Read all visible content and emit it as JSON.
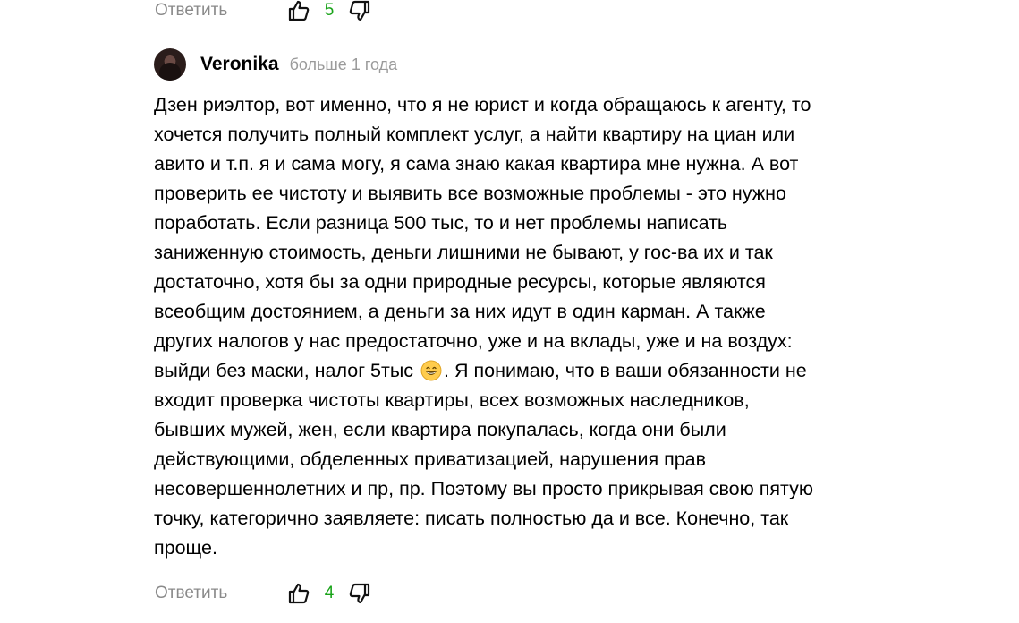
{
  "prev_comment": {
    "reply_label": "Ответить",
    "likes": "5"
  },
  "comment": {
    "author": "Veronika",
    "time": "больше 1 года",
    "lines": [
      "Дзен риэлтор, вот именно, что я не юрист и когда обращаюсь к агенту, то",
      "хочется получить полный комплект услуг, а найти квартиру на циан или",
      "авито и т.п. я и сама могу, я сама знаю какая квартира мне нужна. А вот",
      "проверить ее чистоту и выявить все возможные проблемы - это нужно",
      "поработать. Если разница 500 тыс, то и нет проблемы написать",
      "заниженную стоимость, деньги лишними не бывают, у гос-ва их и так",
      "достаточно, хотя бы за одни природные ресурсы, которые являются",
      "всеобщим достоянием, а деньги за них идут в один карман. А также",
      "других налогов у нас предостаточно, уже и на вклады, уже и на воздух:"
    ],
    "line_emoji_before": "выйди без маски, налог 5тыс",
    "line_emoji_after": ". Я понимаю, что в ваши обязанности не",
    "lines_after": [
      "входит проверка чистоты квартиры, всех возможных наследников,",
      "бывших мужей, жен, если квартира покупалась, когда они были",
      "действующими, обделенных приватизацией, нарушения прав",
      "несовершеннолетних и пр, пр. Поэтому вы просто прикрывая свою пятую",
      "точку, категорично заявляете: писать полностью да и все. Конечно, так",
      "проще."
    ],
    "reply_label": "Ответить",
    "likes": "4"
  },
  "colors": {
    "muted": "#8a8a8a",
    "likes": "#19a319"
  }
}
